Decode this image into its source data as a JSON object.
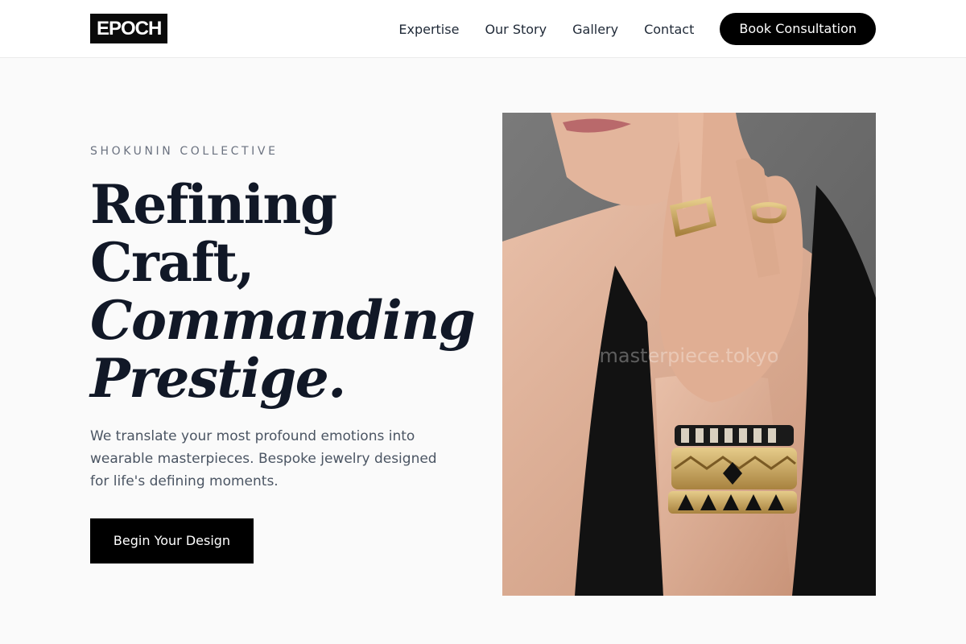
{
  "brand": {
    "logo_text": "EPOCH"
  },
  "nav": {
    "links": [
      "Expertise",
      "Our Story",
      "Gallery",
      "Contact"
    ],
    "cta_label": "Book Consultation"
  },
  "hero": {
    "eyebrow": "SHOKUNIN COLLECTIVE",
    "headline_lines": [
      "Refining",
      "Craft,",
      "Commanding",
      "Prestige."
    ],
    "description": "We translate your most profound emotions into wearable masterpieces. Bespoke jewelry designed for life's defining moments.",
    "cta_label": "Begin Your Design",
    "image": {
      "subject": "woman-hand-with-gold-rings-and-bracelets",
      "watermark": "masterpiece.tokyo"
    }
  },
  "colors": {
    "page_background": "#fafafa",
    "header_background": "#ffffff",
    "primary": "#000000",
    "heading_text": "#111827",
    "body_text": "#4b5563",
    "eyebrow_text": "#6b7280",
    "gold": "#c9a55a"
  }
}
